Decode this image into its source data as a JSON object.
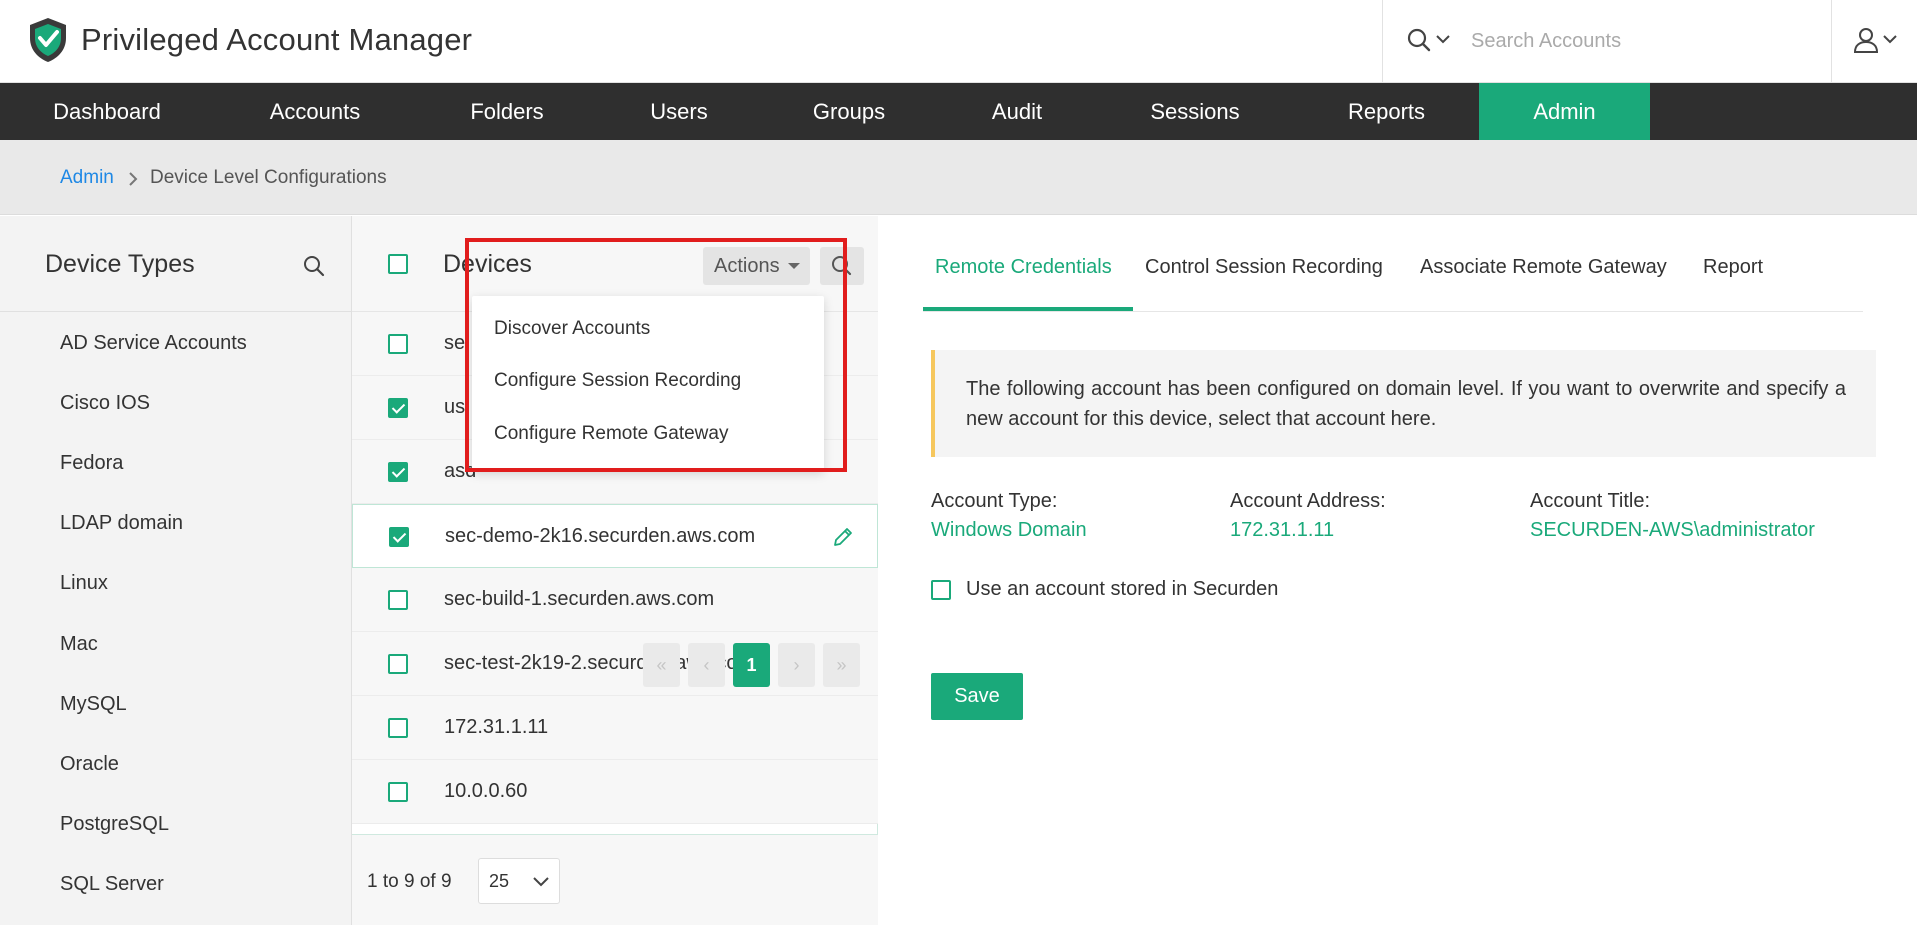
{
  "header": {
    "app_title": "Privileged Account Manager",
    "search_placeholder": "Search Accounts",
    "icons": [
      "shield-logo-icon",
      "search-icon",
      "chevron-down-icon",
      "user-icon"
    ]
  },
  "nav": {
    "items": [
      "Dashboard",
      "Accounts",
      "Folders",
      "Users",
      "Groups",
      "Audit",
      "Sessions",
      "Reports",
      "Admin"
    ],
    "active": "Admin"
  },
  "breadcrumb": {
    "root": "Admin",
    "current": "Device Level Configurations"
  },
  "sidebar": {
    "title": "Device Types",
    "items": [
      "AD Service Accounts",
      "Cisco IOS",
      "Fedora",
      "LDAP domain",
      "Linux",
      "Mac",
      "MySQL",
      "Oracle",
      "PostgreSQL",
      "SQL Server"
    ]
  },
  "devices": {
    "title": "Devices",
    "actions_label": "Actions",
    "rows": [
      {
        "name": "se",
        "checked": false
      },
      {
        "name": "us",
        "checked": true
      },
      {
        "name": "asd",
        "checked": true
      },
      {
        "name": "sec-demo-2k16.securden.aws.com",
        "checked": true
      },
      {
        "name": "sec-build-1.securden.aws.com",
        "checked": false
      },
      {
        "name": "sec-test-2k19-2.securden.aws.com",
        "checked": false
      },
      {
        "name": "172.31.1.11",
        "checked": false
      },
      {
        "name": "10.0.0.60",
        "checked": false
      }
    ],
    "pager": {
      "summary": "1 to 9 of 9",
      "page_size": "25",
      "first": "«",
      "prev": "‹",
      "current_page": "1",
      "next": "›",
      "last": "»"
    }
  },
  "actions_menu": {
    "items": [
      "Discover Accounts",
      "Configure Session Recording",
      "Configure Remote Gateway"
    ]
  },
  "details": {
    "tabs": [
      "Remote Credentials",
      "Control Session Recording",
      "Associate Remote Gateway",
      "Report"
    ],
    "active_tab": "Remote Credentials",
    "info_text": "The following account has been configured on domain level. If you want to overwrite and specify a new account for this device, select that account here.",
    "account_type_label": "Account Type:",
    "account_type_value": "Windows Domain",
    "account_address_label": "Account Address:",
    "account_address_value": "172.31.1.11",
    "account_title_label": "Account Title:",
    "account_title_value": "SECURDEN-AWS\\administrator",
    "use_stored_label": "Use an account stored in Securden",
    "save_label": "Save"
  },
  "colors": {
    "brand_green": "#1aa97a",
    "nav_bg": "#2f2f2f",
    "link_blue": "#1e88e5",
    "highlight_red": "#e11d1d",
    "info_accent": "#f6c75d"
  }
}
